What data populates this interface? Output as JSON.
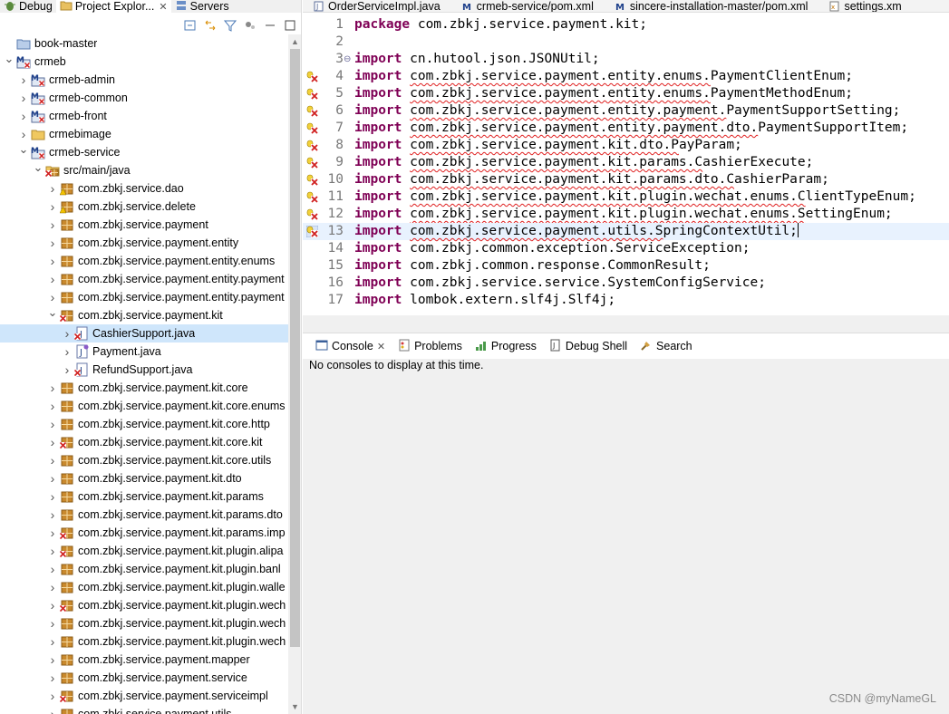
{
  "view_tabs": [
    {
      "label": "Debug",
      "icon": "debug-icon"
    },
    {
      "label": "Project Explor...",
      "icon": "project-explorer-icon",
      "active": true
    },
    {
      "label": "Servers",
      "icon": "servers-icon"
    }
  ],
  "tree": [
    {
      "label": "book-master",
      "depth": 0,
      "icon": "folder-closed-project",
      "twisty": "none"
    },
    {
      "label": "crmeb",
      "depth": 0,
      "icon": "maven-project",
      "twisty": "open"
    },
    {
      "label": "crmeb-admin",
      "depth": 1,
      "icon": "maven-project",
      "twisty": "closed"
    },
    {
      "label": "crmeb-common",
      "depth": 1,
      "icon": "maven-project",
      "twisty": "closed"
    },
    {
      "label": "crmeb-front",
      "depth": 1,
      "icon": "maven-project",
      "twisty": "closed"
    },
    {
      "label": "crmebimage",
      "depth": 1,
      "icon": "folder",
      "twisty": "closed"
    },
    {
      "label": "crmeb-service",
      "depth": 1,
      "icon": "maven-project",
      "twisty": "open"
    },
    {
      "label": "src/main/java",
      "depth": 2,
      "icon": "source-folder",
      "twisty": "open"
    },
    {
      "label": "com.zbkj.service.dao",
      "depth": 3,
      "icon": "package-warn",
      "twisty": "closed"
    },
    {
      "label": "com.zbkj.service.delete",
      "depth": 3,
      "icon": "package-warn",
      "twisty": "closed"
    },
    {
      "label": "com.zbkj.service.payment",
      "depth": 3,
      "icon": "package",
      "twisty": "closed"
    },
    {
      "label": "com.zbkj.service.payment.entity",
      "depth": 3,
      "icon": "package",
      "twisty": "closed"
    },
    {
      "label": "com.zbkj.service.payment.entity.enums",
      "depth": 3,
      "icon": "package",
      "twisty": "closed"
    },
    {
      "label": "com.zbkj.service.payment.entity.payment",
      "depth": 3,
      "icon": "package",
      "twisty": "closed"
    },
    {
      "label": "com.zbkj.service.payment.entity.payment",
      "depth": 3,
      "icon": "package",
      "twisty": "closed"
    },
    {
      "label": "com.zbkj.service.payment.kit",
      "depth": 3,
      "icon": "package-error",
      "twisty": "open"
    },
    {
      "label": "CashierSupport.java",
      "depth": 4,
      "icon": "java-error",
      "twisty": "closed",
      "selected": true
    },
    {
      "label": "Payment.java",
      "depth": 4,
      "icon": "java-interface",
      "twisty": "closed"
    },
    {
      "label": "RefundSupport.java",
      "depth": 4,
      "icon": "java-error",
      "twisty": "closed"
    },
    {
      "label": "com.zbkj.service.payment.kit.core",
      "depth": 3,
      "icon": "package",
      "twisty": "closed"
    },
    {
      "label": "com.zbkj.service.payment.kit.core.enums",
      "depth": 3,
      "icon": "package",
      "twisty": "closed"
    },
    {
      "label": "com.zbkj.service.payment.kit.core.http",
      "depth": 3,
      "icon": "package",
      "twisty": "closed"
    },
    {
      "label": "com.zbkj.service.payment.kit.core.kit",
      "depth": 3,
      "icon": "package-error",
      "twisty": "closed"
    },
    {
      "label": "com.zbkj.service.payment.kit.core.utils",
      "depth": 3,
      "icon": "package",
      "twisty": "closed"
    },
    {
      "label": "com.zbkj.service.payment.kit.dto",
      "depth": 3,
      "icon": "package",
      "twisty": "closed"
    },
    {
      "label": "com.zbkj.service.payment.kit.params",
      "depth": 3,
      "icon": "package",
      "twisty": "closed"
    },
    {
      "label": "com.zbkj.service.payment.kit.params.dto",
      "depth": 3,
      "icon": "package",
      "twisty": "closed"
    },
    {
      "label": "com.zbkj.service.payment.kit.params.imp",
      "depth": 3,
      "icon": "package-error",
      "twisty": "closed"
    },
    {
      "label": "com.zbkj.service.payment.kit.plugin.alipa",
      "depth": 3,
      "icon": "package-error",
      "twisty": "closed"
    },
    {
      "label": "com.zbkj.service.payment.kit.plugin.banl",
      "depth": 3,
      "icon": "package",
      "twisty": "closed"
    },
    {
      "label": "com.zbkj.service.payment.kit.plugin.walle",
      "depth": 3,
      "icon": "package",
      "twisty": "closed"
    },
    {
      "label": "com.zbkj.service.payment.kit.plugin.wech",
      "depth": 3,
      "icon": "package-error",
      "twisty": "closed"
    },
    {
      "label": "com.zbkj.service.payment.kit.plugin.wech",
      "depth": 3,
      "icon": "package",
      "twisty": "closed"
    },
    {
      "label": "com.zbkj.service.payment.kit.plugin.wech",
      "depth": 3,
      "icon": "package",
      "twisty": "closed"
    },
    {
      "label": "com.zbkj.service.payment.mapper",
      "depth": 3,
      "icon": "package",
      "twisty": "closed"
    },
    {
      "label": "com.zbkj.service.payment.service",
      "depth": 3,
      "icon": "package",
      "twisty": "closed"
    },
    {
      "label": "com.zbkj.service.payment.serviceimpl",
      "depth": 3,
      "icon": "package-error",
      "twisty": "closed"
    },
    {
      "label": "com.zbkj.service.payment.utils",
      "depth": 3,
      "icon": "package",
      "twisty": "closed"
    }
  ],
  "editor_tabs": [
    {
      "label": "OrderServiceImpl.java",
      "icon": "java-file-icon"
    },
    {
      "label": "crmeb-service/pom.xml",
      "icon": "maven-file-icon"
    },
    {
      "label": "sincere-installation-master/pom.xml",
      "icon": "maven-file-icon"
    },
    {
      "label": "settings.xm",
      "icon": "xml-file-icon"
    }
  ],
  "code_lines": [
    {
      "n": "1",
      "kw": "package",
      "rest": " com.zbkj.service.payment.kit;",
      "err": false,
      "marker": ""
    },
    {
      "n": "2",
      "kw": "",
      "rest": "",
      "err": false,
      "marker": ""
    },
    {
      "n": "3",
      "kw": "import",
      "rest": " cn.hutool.json.JSONUtil;",
      "err": false,
      "marker": "",
      "fold": true
    },
    {
      "n": "4",
      "kw": "import",
      "rest": " com.zbkj.service.payment.entity.enums.PaymentClientEnum;",
      "err": true,
      "errlen": 38,
      "marker": "error"
    },
    {
      "n": "5",
      "kw": "import",
      "rest": " com.zbkj.service.payment.entity.enums.PaymentMethodEnum;",
      "err": true,
      "errlen": 38,
      "marker": "error"
    },
    {
      "n": "6",
      "kw": "import",
      "rest": " com.zbkj.service.payment.entity.payment.PaymentSupportSetting;",
      "err": true,
      "errlen": 40,
      "marker": "error"
    },
    {
      "n": "7",
      "kw": "import",
      "rest": " com.zbkj.service.payment.entity.payment.dto.PaymentSupportItem;",
      "err": true,
      "errlen": 44,
      "marker": "error"
    },
    {
      "n": "8",
      "kw": "import",
      "rest": " com.zbkj.service.payment.kit.dto.PayParam;",
      "err": true,
      "errlen": 34,
      "marker": "error"
    },
    {
      "n": "9",
      "kw": "import",
      "rest": " com.zbkj.service.payment.kit.params.CashierExecute;",
      "err": true,
      "errlen": 37,
      "marker": "error"
    },
    {
      "n": "10",
      "kw": "import",
      "rest": " com.zbkj.service.payment.kit.params.dto.CashierParam;",
      "err": true,
      "errlen": 41,
      "marker": "error"
    },
    {
      "n": "11",
      "kw": "import",
      "rest": " com.zbkj.service.payment.kit.plugin.wechat.enums.ClientTypeEnum;",
      "err": true,
      "errlen": 50,
      "marker": "error"
    },
    {
      "n": "12",
      "kw": "import",
      "rest": " com.zbkj.service.payment.kit.plugin.wechat.enums.SettingEnum;",
      "err": true,
      "errlen": 50,
      "marker": "error"
    },
    {
      "n": "13",
      "kw": "import",
      "rest": " com.zbkj.service.payment.utils.SpringContextUtil;",
      "err": true,
      "errlen": 32,
      "marker": "error-current",
      "current": true
    },
    {
      "n": "14",
      "kw": "import",
      "rest": " com.zbkj.common.exception.ServiceException;",
      "err": false,
      "marker": ""
    },
    {
      "n": "15",
      "kw": "import",
      "rest": " com.zbkj.common.response.CommonResult;",
      "err": false,
      "marker": ""
    },
    {
      "n": "16",
      "kw": "import",
      "rest": " com.zbkj.service.service.SystemConfigService;",
      "err": false,
      "marker": ""
    },
    {
      "n": "17",
      "kw": "import",
      "rest": " lombok.extern.slf4j.Slf4j;",
      "err": false,
      "marker": ""
    }
  ],
  "console_tabs": [
    {
      "label": "Console",
      "icon": "console-icon",
      "active": true,
      "closable": true
    },
    {
      "label": "Problems",
      "icon": "problems-icon"
    },
    {
      "label": "Progress",
      "icon": "progress-icon"
    },
    {
      "label": "Debug Shell",
      "icon": "debug-shell-icon"
    },
    {
      "label": "Search",
      "icon": "search-icon"
    }
  ],
  "console_message": "No consoles to display at this time.",
  "watermark": "CSDN @myNameGL",
  "colors": {
    "keyword": "#7f0055",
    "selection": "#cfe6fb",
    "current_line": "#e8f2fe",
    "error": "#e02020"
  }
}
